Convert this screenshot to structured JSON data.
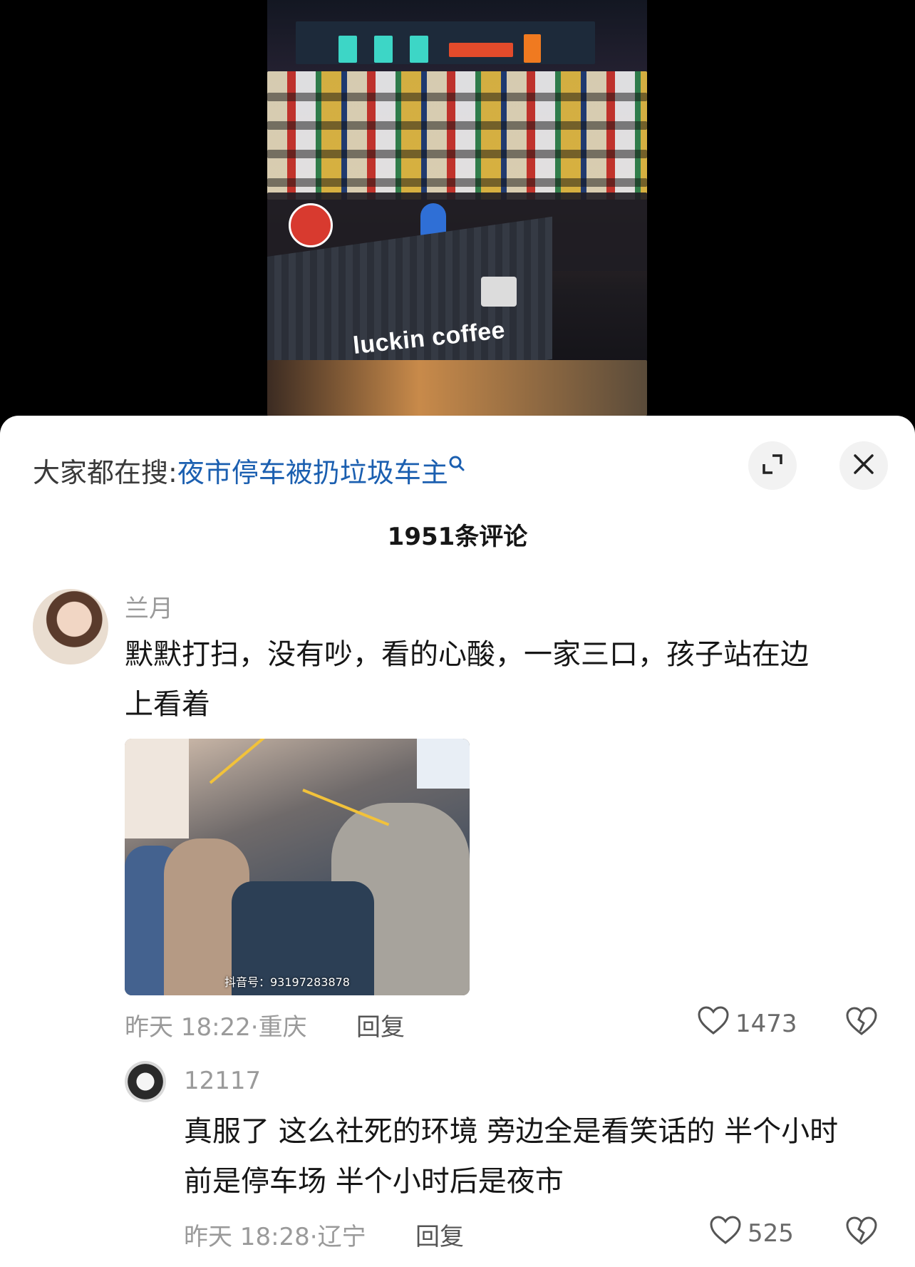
{
  "video": {
    "cafe_sign": "luckin coffee"
  },
  "search": {
    "prefix": "大家都在搜:",
    "term": "夜市停车被扔垃圾车主"
  },
  "icons": {
    "search": "search-icon",
    "expand": "expand-icon",
    "close": "close-icon",
    "like": "heart-icon",
    "dislike": "broken-heart-icon"
  },
  "comments_count": "1951条评论",
  "comments": [
    {
      "user": "兰月",
      "text_line1": "默默打扫，没有吵，看的心酸，一家三口，孩子站在边",
      "text_line2": "上看着",
      "image_watermark": "抖音号：93197283878",
      "time": "昨天 18:22",
      "location": "重庆",
      "reply_label": "回复",
      "likes": "1473"
    },
    {
      "user": "12117",
      "text_line1": "真服了 这么社死的环境 旁边全是看笑话的 半个小时",
      "text_line2": "前是停车场 半个小时后是夜市",
      "time": "昨天 18:28",
      "location": "辽宁",
      "reply_label": "回复",
      "likes": "525"
    }
  ],
  "colors": {
    "link": "#1b5fb0",
    "meta": "#9a9a9a",
    "text": "#161616"
  }
}
